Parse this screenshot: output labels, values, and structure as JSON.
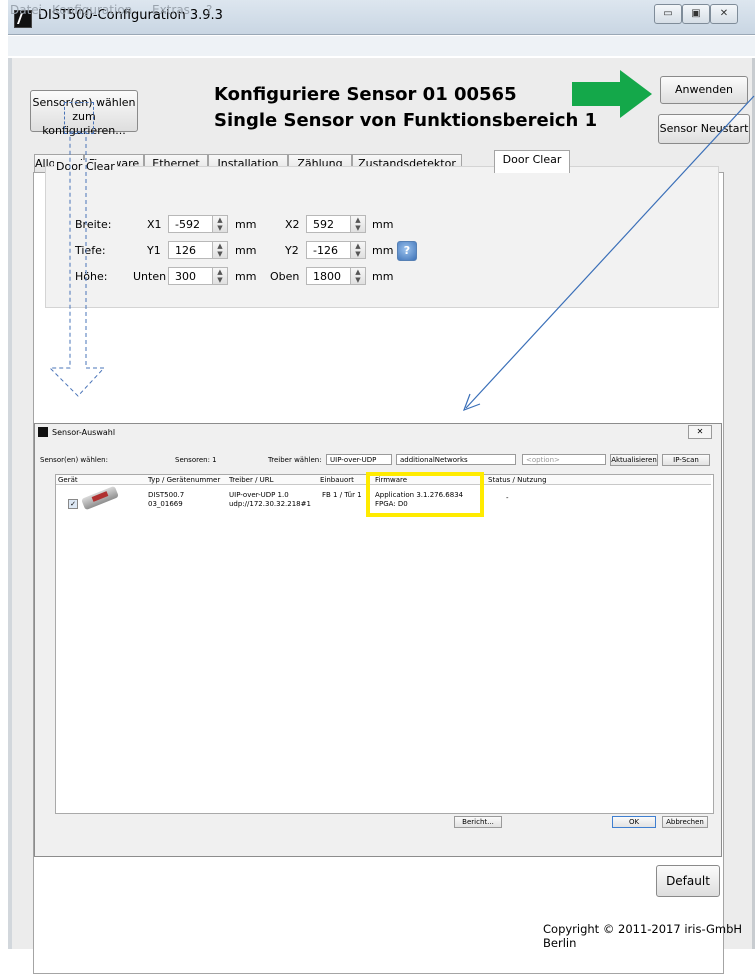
{
  "window": {
    "title": "DIST500-Configuration 3.9.3",
    "buttons": [
      "▭",
      "▣",
      "✕"
    ]
  },
  "menu": [
    "Datei",
    "Konfiguration",
    "Extras",
    "?"
  ],
  "toolbar": {
    "select_sensor_line1": "Sensor(en) wählen",
    "select_sensor_line2": "zum konfigurieren...",
    "heading_line1": "Konfiguriere Sensor 01  00565",
    "heading_line2": "Single Sensor von Funktionsbereich 1",
    "apply_label": "Anwenden",
    "restart_label": "Sensor Neustart"
  },
  "tabs": [
    "Allgemein",
    "Firmware",
    "Ethernet",
    "Installation",
    "Zählung",
    "Zustandsdetektor",
    "Door Clear"
  ],
  "active_tab": "Door Clear",
  "door_clear": {
    "group_title": "Door Clear",
    "rows": [
      {
        "label": "Breite:",
        "a_label": "X1",
        "a_value": "-592",
        "a_unit": "mm",
        "b_label": "X2",
        "b_value": "592",
        "b_unit": "mm"
      },
      {
        "label": "Tiefe:",
        "a_label": "Y1",
        "a_value": "126",
        "a_unit": "mm",
        "b_label": "Y2",
        "b_value": "-126",
        "b_unit": "mm"
      },
      {
        "label": "Höhe:",
        "a_label": "Unten",
        "a_value": "300",
        "a_unit": "mm",
        "b_label": "Oben",
        "b_value": "1800",
        "b_unit": "mm"
      }
    ],
    "help_label": "?"
  },
  "dialog": {
    "title": "Sensor-Auswahl",
    "close_label": "✕",
    "select_label": "Sensor(en) wählen:",
    "count_label": "Sensoren: 1",
    "driver_label": "Treiber wählen:",
    "driver_value": "UIP-over-UDP",
    "network_value": "additionalNetworks",
    "option_placeholder": "<option>",
    "refresh_label": "Aktualisieren",
    "ipscan_label": "IP-Scan",
    "columns": [
      "Gerät",
      "Typ / Gerätenummer",
      "Treiber / URL",
      "Einbauort",
      "Firmware",
      "Status / Nutzung"
    ],
    "row": {
      "checked": "✓",
      "type": "DIST500.7",
      "number": "03_01669",
      "driver": "UIP-over-UDP 1.0",
      "url": "udp://172.30.32.218#1",
      "location": "FB 1 / Tür 1",
      "firmware": "Application 3.1.276.6834",
      "fpga": "FPGA: D0",
      "status": "-"
    },
    "report_label": "Bericht...",
    "ok_label": "OK",
    "cancel_label": "Abbrechen"
  },
  "default_label": "Default",
  "copyright": "Copyright © 2011-2017 iris-GmbH Berlin",
  "colors": {
    "arrow_green": "#14a84a",
    "highlight": "#ffeb00",
    "annotation_blue": "#3a6fb8"
  }
}
